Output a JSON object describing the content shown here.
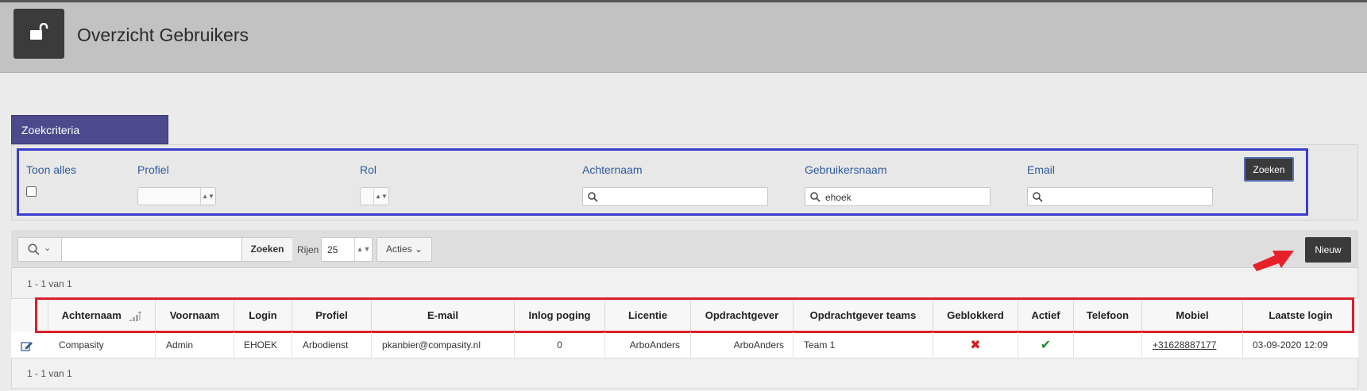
{
  "header": {
    "title": "Overzicht Gebruikers",
    "icon": "unlock-icon"
  },
  "criteria": {
    "tab_label": "Zoekcriteria",
    "toon_alles_label": "Toon alles",
    "toon_alles_checked": false,
    "profiel_label": "Profiel",
    "profiel_value": "",
    "rol_label": "Rol",
    "rol_value": "",
    "achternaam_label": "Achternaam",
    "achternaam_value": "",
    "gebruikersnaam_label": "Gebruikersnaam",
    "gebruikersnaam_value": "ehoek",
    "email_label": "Email",
    "email_value": "",
    "search_button": "Zoeken"
  },
  "toolbar": {
    "search_value": "",
    "search_button": "Zoeken",
    "rows_label": "Rijen",
    "rows_value": "25",
    "actions_label": "Acties",
    "new_button": "Nieuw"
  },
  "pagination": {
    "range_top": "1 - 1 van 1",
    "range_bottom": "1 - 1 van 1"
  },
  "table": {
    "columns": [
      "Achternaam",
      "Voornaam",
      "Login",
      "Profiel",
      "E-mail",
      "Inlog poging",
      "Licentie",
      "Opdrachtgever",
      "Opdrachtgever teams",
      "Geblokkerd",
      "Actief",
      "Telefoon",
      "Mobiel",
      "Laatste login"
    ],
    "rows": [
      {
        "achternaam": "Compasity",
        "voornaam": "Admin",
        "login": "EHOEK",
        "profiel": "Arbodienst",
        "email": "pkanbier@compasity.nl",
        "inlog_poging": "0",
        "licentie": "ArboAnders",
        "opdrachtgever": "ArboAnders",
        "opdrachtgever_teams": "Team 1",
        "geblokkerd_icon": "cross-icon",
        "actief_icon": "check-icon",
        "telefoon": "",
        "mobiel": "+31628887177",
        "laatste_login": "03-09-2020 12:09"
      }
    ]
  },
  "colors": {
    "header_bg": "#c2c2c2",
    "tab_bg": "#4c4a8c",
    "label_blue": "#2f5a9e",
    "criteria_highlight": "#3b3bd0",
    "table_highlight": "#d9202a",
    "button_dark": "#3a3a3a"
  }
}
